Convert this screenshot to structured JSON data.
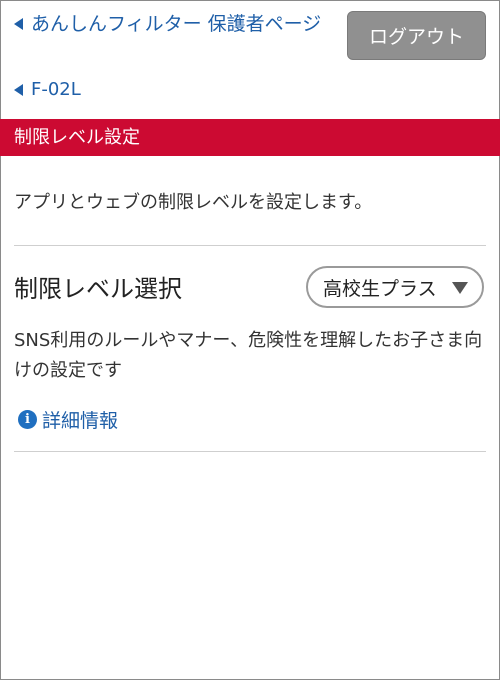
{
  "header": {
    "back_link_filter": "あんしんフィルター 保護者ページ",
    "back_link_device": "F-02L",
    "logout_label": "ログアウト"
  },
  "section": {
    "title": "制限レベル設定"
  },
  "main": {
    "description": "アプリとウェブの制限レベルを設定します。",
    "level_select": {
      "label": "制限レベル選択",
      "selected_value": "高校生プラス"
    },
    "level_note": "SNS利用のルールやマナー、危険性を理解したお子さま向けの設定です",
    "info_link_label": "詳細情報"
  },
  "icons": {
    "back": "caret-left-icon",
    "info": "info-circle-icon",
    "dropdown": "caret-down-icon"
  },
  "colors": {
    "link": "#1f5fa8",
    "section_bar": "#cc0a32",
    "logout_button": "#909090"
  }
}
